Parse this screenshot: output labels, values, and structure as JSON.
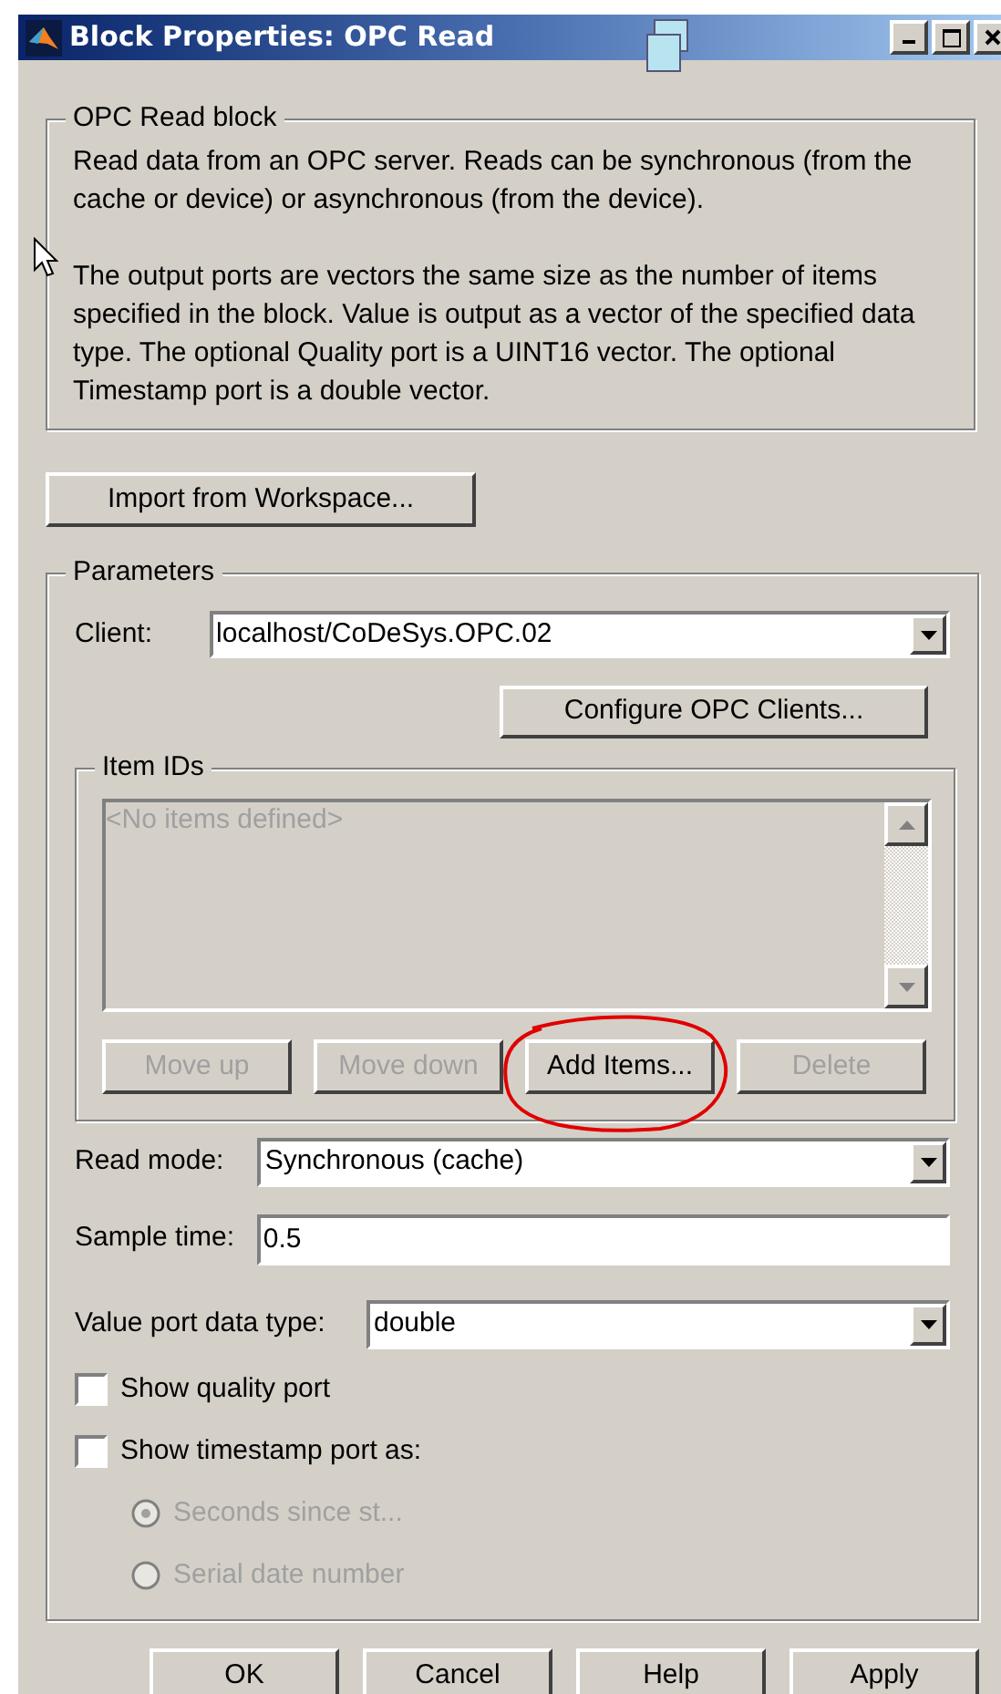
{
  "window": {
    "title": "Block Properties: OPC Read"
  },
  "description": {
    "heading": "OPC Read block",
    "paragraphs": [
      "Read data from an OPC server. Reads can be synchronous (from the cache or device) or asynchronous (from the device).",
      "The output ports are vectors the same size as the number of items specified in the block. Value is output as a vector of the specified data type. The optional Quality port is a UINT16 vector. The optional Timestamp port is a double vector."
    ]
  },
  "import_button": "Import from Workspace...",
  "parameters": {
    "heading": "Parameters",
    "client": {
      "label": "Client:",
      "value": "localhost/CoDeSys.OPC.02"
    },
    "configure_button": "Configure OPC Clients...",
    "item_ids": {
      "heading": "Item IDs",
      "empty_text": "<No items defined>",
      "buttons": [
        {
          "label": "Move up",
          "disabled": true
        },
        {
          "label": "Move down",
          "disabled": true
        },
        {
          "label": "Add Items...",
          "disabled": false
        },
        {
          "label": "Delete",
          "disabled": true
        }
      ]
    },
    "read_mode": {
      "label": "Read mode:",
      "value": "Synchronous (cache)"
    },
    "sample_time": {
      "label": "Sample time:",
      "value": "0.5"
    },
    "value_port_type": {
      "label": "Value port data type:",
      "value": "double"
    },
    "checkboxes": [
      {
        "label": "Show quality port",
        "checked": false
      },
      {
        "label": "Show timestamp port as:",
        "checked": false
      }
    ],
    "radios": [
      {
        "label": "Seconds since st...",
        "selected": true,
        "disabled": true
      },
      {
        "label": "Serial date number",
        "selected": false,
        "disabled": true
      }
    ]
  },
  "buttons": [
    "OK",
    "Cancel",
    "Help",
    "Apply"
  ]
}
